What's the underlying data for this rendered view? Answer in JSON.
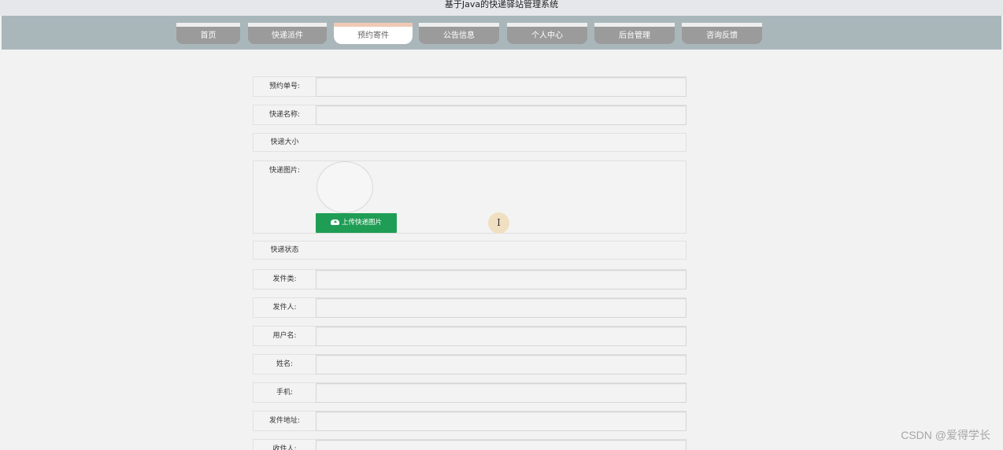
{
  "site": {
    "title": "基于Java的快递驿站管理系统"
  },
  "nav": {
    "tabs": [
      {
        "label": "首页"
      },
      {
        "label": "快递派件"
      },
      {
        "label": "预约寄件"
      },
      {
        "label": "公告信息"
      },
      {
        "label": "个人中心"
      },
      {
        "label": "后台管理"
      },
      {
        "label": "咨询反馈"
      }
    ],
    "active_index": 2
  },
  "form": {
    "order_no_label": "预约单号:",
    "name_label": "快递名称:",
    "size_label": "快递大小",
    "image_label": "快递图片:",
    "upload_label": "上传快递图片",
    "status_label": "快递状态",
    "category_label": "发件类:",
    "sender_label": "发件人:",
    "username_label": "用户名:",
    "realname_label": "姓名:",
    "phone_label": "手机:",
    "address_label": "发件地址:",
    "receiver_label": "收件人:"
  },
  "cursor": {
    "glyph": "I"
  },
  "watermark": "CSDN @爱得学长",
  "colors": {
    "nav_bar": "#a9b7bb",
    "nav_tab": "#9b9b9b",
    "nav_active": "#ffffff",
    "upload_button": "#1f9d55"
  }
}
